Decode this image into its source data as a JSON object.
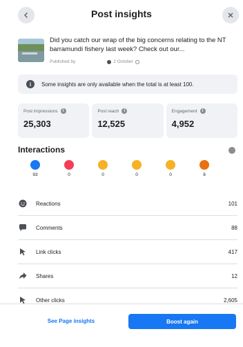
{
  "header": {
    "title": "Post insights"
  },
  "post": {
    "text": "Did you catch our wrap of the big concerns relating to the NT barramundi fishery last week? Check out our...",
    "published_by": "Published by",
    "date": "2 October"
  },
  "notice": {
    "text": "Some insights are only available when the total is at least 100."
  },
  "stats": [
    {
      "label": "Post impressions",
      "value": "25,303"
    },
    {
      "label": "Post reach",
      "value": "12,525"
    },
    {
      "label": "Engagement",
      "value": "4,952"
    }
  ],
  "interactions": {
    "title": "Interactions",
    "reactions": [
      {
        "name": "like",
        "count": "93",
        "color": "#1877f2"
      },
      {
        "name": "love",
        "count": "0",
        "color": "#f33e58"
      },
      {
        "name": "haha",
        "count": "0",
        "color": "#f7b125"
      },
      {
        "name": "wow",
        "count": "0",
        "color": "#f7b125"
      },
      {
        "name": "sad",
        "count": "0",
        "color": "#f7b125"
      },
      {
        "name": "angry",
        "count": "8",
        "color": "#e9710f"
      }
    ],
    "rows": [
      {
        "label": "Reactions",
        "value": "101",
        "icon": "reactions-icon"
      },
      {
        "label": "Comments",
        "value": "88",
        "icon": "comment-icon"
      },
      {
        "label": "Link clicks",
        "value": "417",
        "icon": "cursor-icon"
      },
      {
        "label": "Shares",
        "value": "12",
        "icon": "share-icon"
      },
      {
        "label": "Other clicks",
        "value": "2,605",
        "icon": "cursor-icon"
      }
    ]
  },
  "footer": {
    "link_label": "See Page insights",
    "primary_label": "Boost again"
  },
  "colors": {
    "accent": "#1877f2",
    "panel": "#f0f2f5",
    "text": "#1c1e21",
    "muted": "#65676b"
  }
}
